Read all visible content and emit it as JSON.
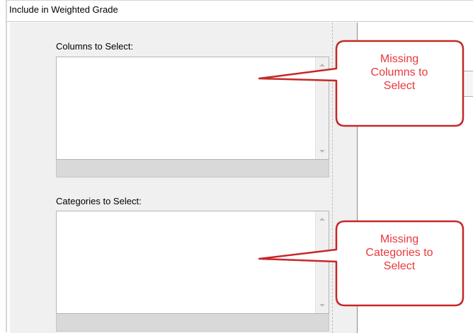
{
  "header": {
    "title": "Include in Weighted Grade"
  },
  "columns": {
    "label": "Columns to Select:"
  },
  "categories": {
    "label": "Categories to Select:"
  },
  "callouts": [
    {
      "lines": [
        "Missing",
        "Columns to",
        "Select"
      ]
    },
    {
      "lines": [
        "Missing",
        "Categories to",
        "Select"
      ]
    }
  ],
  "colors": {
    "callout_border": "#c62828",
    "callout_text": "#e8383b",
    "panel_bg": "#f0f0f0"
  },
  "icons": [
    "scroll-up-arrow-icon",
    "scroll-down-arrow-icon"
  ]
}
